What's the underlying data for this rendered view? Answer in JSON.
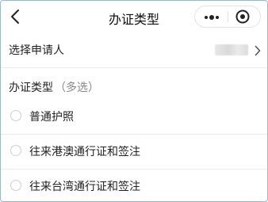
{
  "nav": {
    "title": "办证类型",
    "icons": {
      "back": "chevron-left-icon",
      "more": "more-dots-icon",
      "close": "target-icon"
    }
  },
  "applicant": {
    "label": "选择申请人",
    "value": "",
    "icon": "chevron-right-icon"
  },
  "section": {
    "heading": "办证类型",
    "hint": "（多选）"
  },
  "options": [
    {
      "label": "普通护照",
      "selected": false
    },
    {
      "label": "往来港澳通行证和签注",
      "selected": false
    },
    {
      "label": "往来台湾通行证和签注",
      "selected": false
    }
  ]
}
